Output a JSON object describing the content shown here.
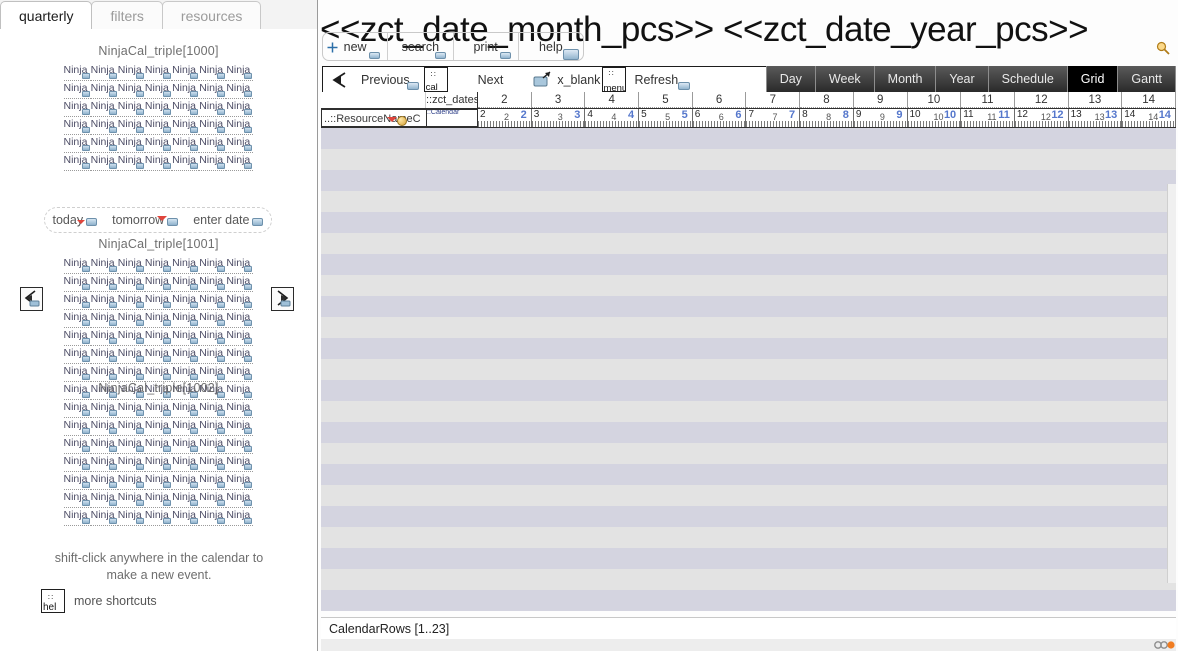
{
  "left_panel": {
    "tabs": [
      {
        "label": "quarterly",
        "active": true
      },
      {
        "label": "filters",
        "active": false
      },
      {
        "label": "resources",
        "active": false
      }
    ],
    "calendars": [
      {
        "title": "NinjaCal_triple[1000]",
        "cell_label": "Ninja",
        "rows": 6,
        "cols": 7
      },
      {
        "title": "NinjaCal_triple[1001]",
        "cell_label": "Ninja",
        "rows": 8,
        "cols": 7
      },
      {
        "title": "NinjaCal_triple[1002]",
        "cell_label": "Ninja",
        "rows": 7,
        "cols": 7
      }
    ],
    "date_shortcuts": [
      {
        "label": "today"
      },
      {
        "label": "tomorrow"
      },
      {
        "label": "enter date"
      }
    ],
    "nav_prev_title": "previous",
    "nav_next_title": "next",
    "hint_text": "shift-click anywhere in the calendar to make a new event.",
    "more_shortcuts_label": "more shortcuts",
    "more_shortcuts_icon_text": "hel"
  },
  "right_panel": {
    "title": "<<zct_date_month_pcs>> <<zct_date_year_pcs>>",
    "toolbar_primary": [
      {
        "label": "new"
      },
      {
        "label": "search"
      },
      {
        "label": "print"
      },
      {
        "label": "help"
      }
    ],
    "toolbar_secondary": {
      "previous_label": "Previous",
      "cal_button_label": "cal",
      "next_label": "Next",
      "blank_label": "x_blank",
      "menu_button_label": "menu",
      "refresh_label": "Refresh"
    },
    "view_tabs": [
      {
        "label": "Day",
        "active": false
      },
      {
        "label": "Week",
        "active": false
      },
      {
        "label": "Month",
        "active": false
      },
      {
        "label": "Year",
        "active": false
      },
      {
        "label": "Schedule",
        "active": false
      },
      {
        "label": "Grid",
        "active": true
      },
      {
        "label": "Gantt",
        "active": false
      }
    ],
    "grid": {
      "resource_header": "..::ResourceNameC",
      "dates_field_header": "::zct_dates",
      "calendar_cell_text": "::Calendar",
      "column_numbers": [
        "2",
        "3",
        "4",
        "5",
        "6",
        "7",
        "8",
        "9",
        "10",
        "11",
        "12",
        "13",
        "14"
      ],
      "day_cells": [
        {
          "a": "2",
          "b": "2",
          "c": "2"
        },
        {
          "a": "3",
          "b": "3",
          "c": "3"
        },
        {
          "a": "4",
          "b": "4",
          "c": "4"
        },
        {
          "a": "5",
          "b": "5",
          "c": "5"
        },
        {
          "a": "6",
          "b": "6",
          "c": "6"
        },
        {
          "a": "7",
          "b": "7",
          "c": "7"
        },
        {
          "a": "8",
          "b": "8",
          "c": "8"
        },
        {
          "a": "9",
          "b": "9",
          "c": "9"
        },
        {
          "a": "10",
          "b": "10",
          "c": "10"
        },
        {
          "a": "11",
          "b": "11",
          "c": "11"
        },
        {
          "a": "12",
          "b": "12",
          "c": "12"
        },
        {
          "a": "13",
          "b": "13",
          "c": "13"
        },
        {
          "a": "14",
          "b": "14",
          "c": "14"
        }
      ],
      "row_count": 23
    },
    "status_text": "CalendarRows [1..23]"
  },
  "colors": {
    "row_odd": "#d4d4e0",
    "row_even": "#e3e3e3",
    "view_tab_active_bg": "#000000",
    "accent_red": "#e0453c",
    "chip_blue": "#93b5cf"
  }
}
